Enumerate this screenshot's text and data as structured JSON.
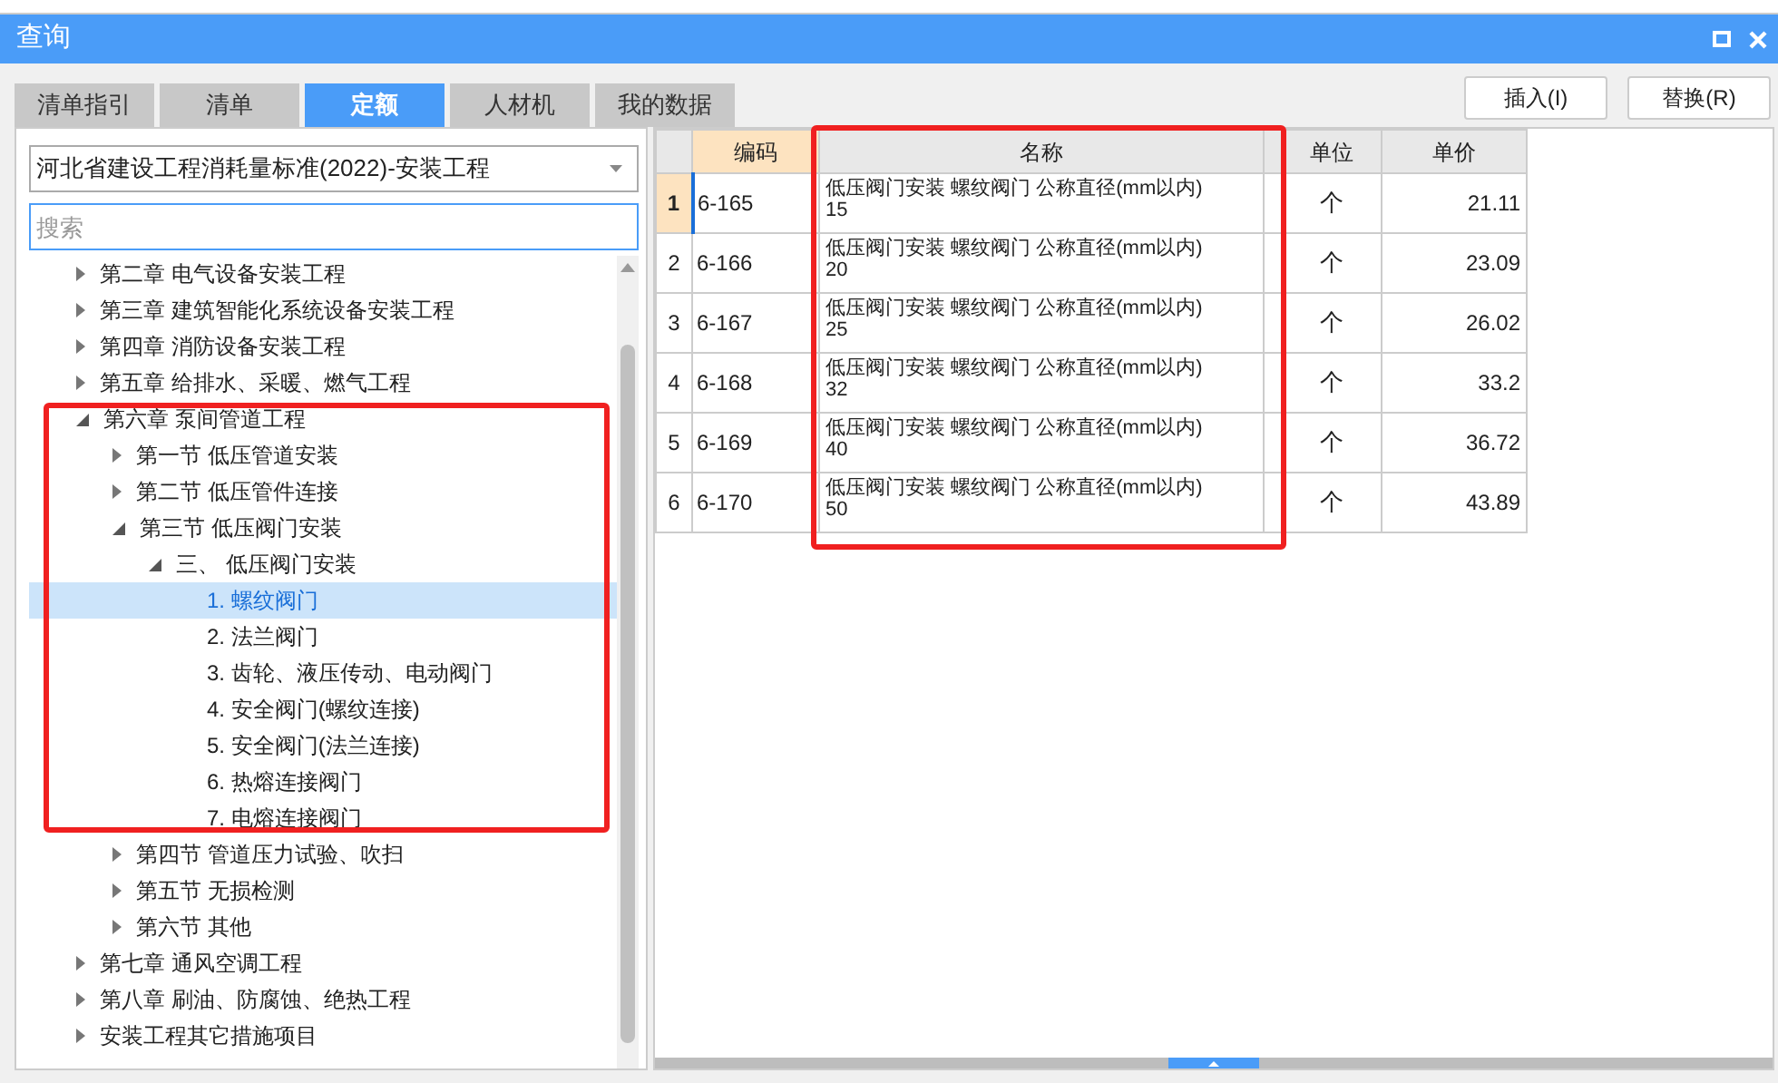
{
  "window": {
    "title": "查询"
  },
  "tabs": [
    {
      "label": "清单指引",
      "selected": false
    },
    {
      "label": "清单",
      "selected": false
    },
    {
      "label": "定额",
      "selected": true
    },
    {
      "label": "人材机",
      "selected": false
    },
    {
      "label": "我的数据",
      "selected": false
    }
  ],
  "buttons": [
    "插入(I)",
    "替换(R)"
  ],
  "library_select": {
    "value": "河北省建设工程消耗量标准(2022)-安装工程"
  },
  "search": {
    "placeholder": "搜索"
  },
  "tree": [
    {
      "label": "第二章 电气设备安装工程",
      "expanded": false,
      "selected": false
    },
    {
      "label": "第三章 建筑智能化系统设备安装工程",
      "expanded": false,
      "selected": false
    },
    {
      "label": "第四章 消防设备安装工程",
      "expanded": false,
      "selected": false
    },
    {
      "label": "第五章 给排水、采暖、燃气工程",
      "expanded": false,
      "selected": false
    },
    {
      "label": "第六章 泵间管道工程",
      "expanded": true,
      "selected": false,
      "children": [
        {
          "label": "第一节 低压管道安装",
          "expanded": false,
          "selected": false
        },
        {
          "label": "第二节 低压管件连接",
          "expanded": false,
          "selected": false
        },
        {
          "label": "第三节 低压阀门安装",
          "expanded": true,
          "selected": false,
          "children": [
            {
              "label": "三、 低压阀门安装",
              "expanded": true,
              "selected": false,
              "children": [
                {
                  "label": "1. 螺纹阀门",
                  "selected": true
                },
                {
                  "label": "2. 法兰阀门",
                  "selected": false
                },
                {
                  "label": "3. 齿轮、液压传动、电动阀门",
                  "selected": false
                },
                {
                  "label": "4. 安全阀门(螺纹连接)",
                  "selected": false
                },
                {
                  "label": "5. 安全阀门(法兰连接)",
                  "selected": false
                },
                {
                  "label": "6. 热熔连接阀门",
                  "selected": false
                },
                {
                  "label": "7. 电熔连接阀门",
                  "selected": false
                }
              ]
            }
          ]
        },
        {
          "label": "第四节 管道压力试验、吹扫",
          "expanded": false,
          "selected": false
        },
        {
          "label": "第五节 无损检测",
          "expanded": false,
          "selected": false
        },
        {
          "label": "第六节 其他",
          "expanded": false,
          "selected": false
        }
      ]
    },
    {
      "label": "第七章 通风空调工程",
      "expanded": false,
      "selected": false
    },
    {
      "label": "第八章 刷油、防腐蚀、绝热工程",
      "expanded": false,
      "selected": false
    },
    {
      "label": "安装工程其它措施项目",
      "expanded": false,
      "selected": false
    }
  ],
  "table": {
    "columns": [
      {
        "label": "编码",
        "selected": true
      },
      {
        "label": "名称",
        "selected": false
      },
      {
        "label": "单位",
        "selected": false
      },
      {
        "label": "单价",
        "selected": false
      }
    ],
    "rows": [
      {
        "number": "1",
        "code": "6-165",
        "name": "低压阀门安装 螺纹阀门 公称直径(mm以内)",
        "size": "15",
        "unit": "个",
        "price": "21.11",
        "selected": true
      },
      {
        "number": "2",
        "code": "6-166",
        "name": "低压阀门安装 螺纹阀门 公称直径(mm以内)",
        "size": "20",
        "unit": "个",
        "price": "23.09",
        "selected": false
      },
      {
        "number": "3",
        "code": "6-167",
        "name": "低压阀门安装 螺纹阀门 公称直径(mm以内)",
        "size": "25",
        "unit": "个",
        "price": "26.02",
        "selected": false
      },
      {
        "number": "4",
        "code": "6-168",
        "name": "低压阀门安装 螺纹阀门 公称直径(mm以内)",
        "size": "32",
        "unit": "个",
        "price": "33.2",
        "selected": false
      },
      {
        "number": "5",
        "code": "6-169",
        "name": "低压阀门安装 螺纹阀门 公称直径(mm以内)",
        "size": "40",
        "unit": "个",
        "price": "36.72",
        "selected": false
      },
      {
        "number": "6",
        "code": "6-170",
        "name": "低压阀门安装 螺纹阀门 公称直径(mm以内)",
        "size": "50",
        "unit": "个",
        "price": "43.89",
        "selected": false
      }
    ]
  }
}
